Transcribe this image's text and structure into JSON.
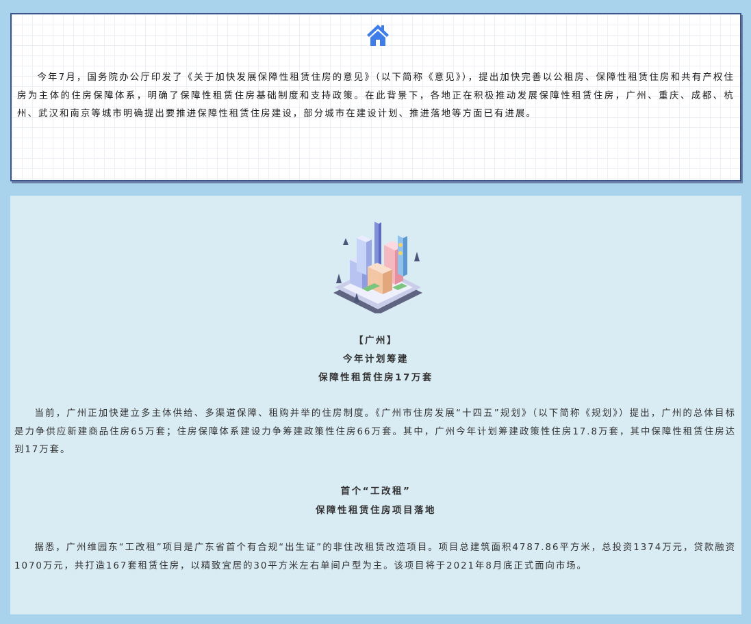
{
  "intro": {
    "icon": "home-icon",
    "text": "今年7月，国务院办公厅印发了《关于加快发展保障性租赁住房的意见》（以下简称《意见》），提出加快完善以公租房、保障性租赁住房和共有产权住房为主体的住房保障体系，明确了保障性租赁住房基础制度和支持政策。在此背景下，各地正在积极推动发展保障性租赁住房，广州、重庆、成都、杭州、武汉和南京等城市明确提出要推进保障性租赁住房建设，部分城市在建设计划、推进落地等方面已有进展。"
  },
  "section": {
    "illustration": "isometric-city-icon",
    "city_title": "【广州】",
    "headline_line1": "今年计划筹建",
    "headline_line2": "保障性租赁住房17万套",
    "paragraph1": "当前，广州正加快建立多主体供给、多渠道保障、租购并举的住房制度。《广州市住房发展“十四五”规划》（以下简称《规划》）提出，广州的总体目标是力争供应新建商品住房65万套；住房保障体系建设力争筹建政策性住房66万套。其中，广州今年计划筹建政策性住房17.8万套，其中保障性租赁住房达到17万套。",
    "subhead_line1": "首个“工改租”",
    "subhead_line2": "保障性租赁住房项目落地",
    "paragraph2": "据悉，广州维园东“工改租”项目是广东省首个有合规“出生证”的非住改租赁改造项目。项目总建筑面积4787.86平方米，总投资1374万元，贷款融资1070万元，共打造167套租赁住房，以精致宜居的30平方米左右单间户型为主。该项目将于2021年8月底正式面向市场。"
  },
  "colors": {
    "page_bg": "#a9d3ec",
    "card_border": "#3e5388",
    "panel_bg": "#d9ebf3",
    "icon_blue": "#3f7ee8"
  }
}
